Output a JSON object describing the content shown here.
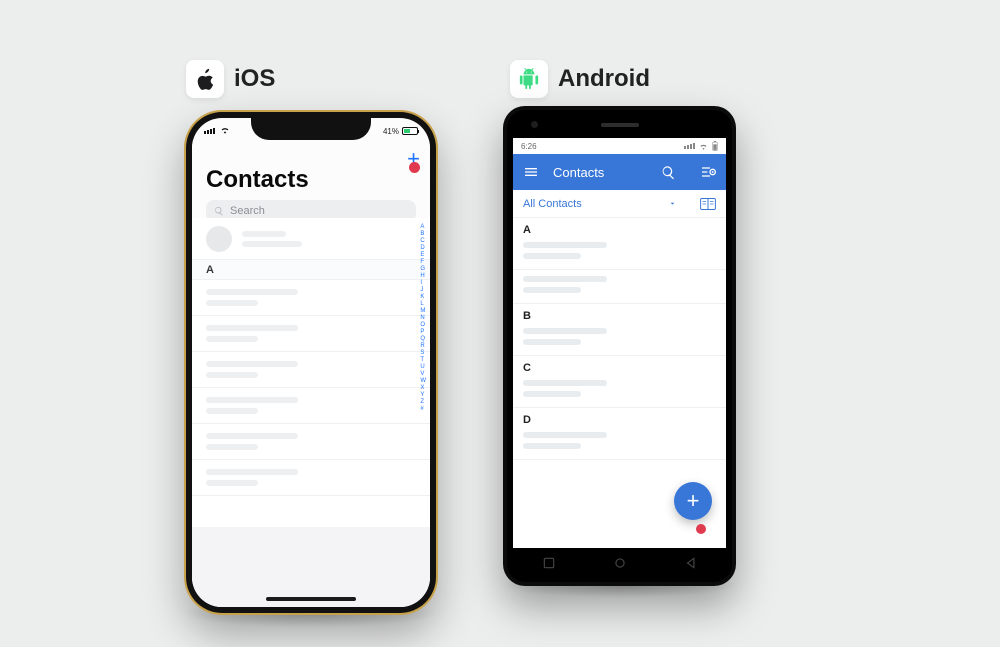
{
  "labels": {
    "ios": "iOS",
    "android": "Android"
  },
  "ios": {
    "status": {
      "battery_pct": "41%"
    },
    "title": "Contacts",
    "search_placeholder": "Search",
    "section_header": "A",
    "index_letters": [
      "A",
      "B",
      "C",
      "D",
      "E",
      "F",
      "G",
      "H",
      "I",
      "J",
      "K",
      "L",
      "M",
      "N",
      "O",
      "P",
      "Q",
      "R",
      "S",
      "T",
      "U",
      "V",
      "W",
      "X",
      "Y",
      "Z",
      "#"
    ]
  },
  "android": {
    "status": {
      "time": "6:26"
    },
    "appbar_title": "Contacts",
    "filter_label": "All Contacts",
    "sections": [
      "A",
      "B",
      "C",
      "D"
    ]
  }
}
